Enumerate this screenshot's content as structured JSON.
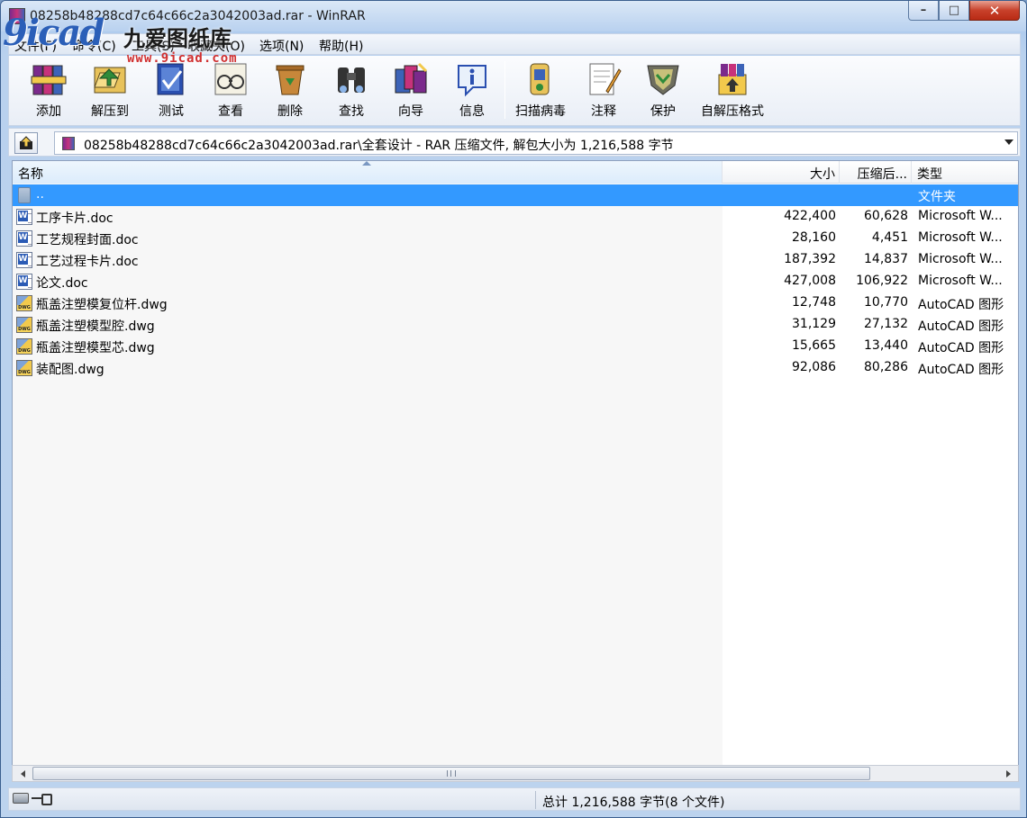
{
  "window": {
    "title": "08258b48288cd7c64c66c2a3042003ad.rar - WinRAR",
    "buttons": {
      "minimize": "–",
      "maximize": "□",
      "close": "✕"
    }
  },
  "watermark": {
    "logo_text": "9icad",
    "name_cn": "九爱图纸库",
    "url": "www.9icad.com"
  },
  "menu": [
    {
      "label": "文件(F)"
    },
    {
      "label": "命令(C)"
    },
    {
      "label": "工具(S)"
    },
    {
      "label": "收藏夹(O)"
    },
    {
      "label": "选项(N)"
    },
    {
      "label": "帮助(H)"
    }
  ],
  "toolbar": [
    {
      "id": "add",
      "label": "添加",
      "icon": "books-stack-icon"
    },
    {
      "id": "extract",
      "label": "解压到",
      "icon": "extract-folder-icon"
    },
    {
      "id": "test",
      "label": "测试",
      "icon": "test-check-icon"
    },
    {
      "id": "view",
      "label": "查看",
      "icon": "glasses-icon"
    },
    {
      "id": "delete",
      "label": "删除",
      "icon": "recycle-bin-icon"
    },
    {
      "id": "find",
      "label": "查找",
      "icon": "binoculars-icon"
    },
    {
      "id": "wizard",
      "label": "向导",
      "icon": "wizard-wand-icon"
    },
    {
      "id": "info",
      "label": "信息",
      "icon": "info-icon"
    },
    {
      "id": "scan",
      "label": "扫描病毒",
      "icon": "virus-scan-icon"
    },
    {
      "id": "comment",
      "label": "注释",
      "icon": "comment-pencil-icon"
    },
    {
      "id": "protect",
      "label": "保护",
      "icon": "shield-icon"
    },
    {
      "id": "sfx",
      "label": "自解压格式",
      "icon": "sfx-box-icon"
    }
  ],
  "address": {
    "text": "08258b48288cd7c64c66c2a3042003ad.rar\\全套设计 - RAR 压缩文件, 解包大小为 1,216,588 字节"
  },
  "columns": {
    "name": "名称",
    "size": "大小",
    "packed": "压缩后...",
    "type": "类型"
  },
  "files": [
    {
      "name": "..",
      "size": "",
      "packed": "",
      "type": "文件夹",
      "icon": "folder-icon",
      "selected": true
    },
    {
      "name": "工序卡片.doc",
      "size": "422,400",
      "packed": "60,628",
      "type": "Microsoft W...",
      "icon": "word-doc-icon"
    },
    {
      "name": "工艺规程封面.doc",
      "size": "28,160",
      "packed": "4,451",
      "type": "Microsoft W...",
      "icon": "word-doc-icon"
    },
    {
      "name": "工艺过程卡片.doc",
      "size": "187,392",
      "packed": "14,837",
      "type": "Microsoft W...",
      "icon": "word-doc-icon"
    },
    {
      "name": "论文.doc",
      "size": "427,008",
      "packed": "106,922",
      "type": "Microsoft W...",
      "icon": "word-doc-icon"
    },
    {
      "name": "瓶盖注塑模复位杆.dwg",
      "size": "12,748",
      "packed": "10,770",
      "type": "AutoCAD 图形",
      "icon": "dwg-file-icon"
    },
    {
      "name": "瓶盖注塑模型腔.dwg",
      "size": "31,129",
      "packed": "27,132",
      "type": "AutoCAD 图形",
      "icon": "dwg-file-icon"
    },
    {
      "name": "瓶盖注塑模型芯.dwg",
      "size": "15,665",
      "packed": "13,440",
      "type": "AutoCAD 图形",
      "icon": "dwg-file-icon"
    },
    {
      "name": "装配图.dwg",
      "size": "92,086",
      "packed": "80,286",
      "type": "AutoCAD 图形",
      "icon": "dwg-file-icon"
    }
  ],
  "status": {
    "summary": "总计 1,216,588 字节(8 个文件)"
  }
}
